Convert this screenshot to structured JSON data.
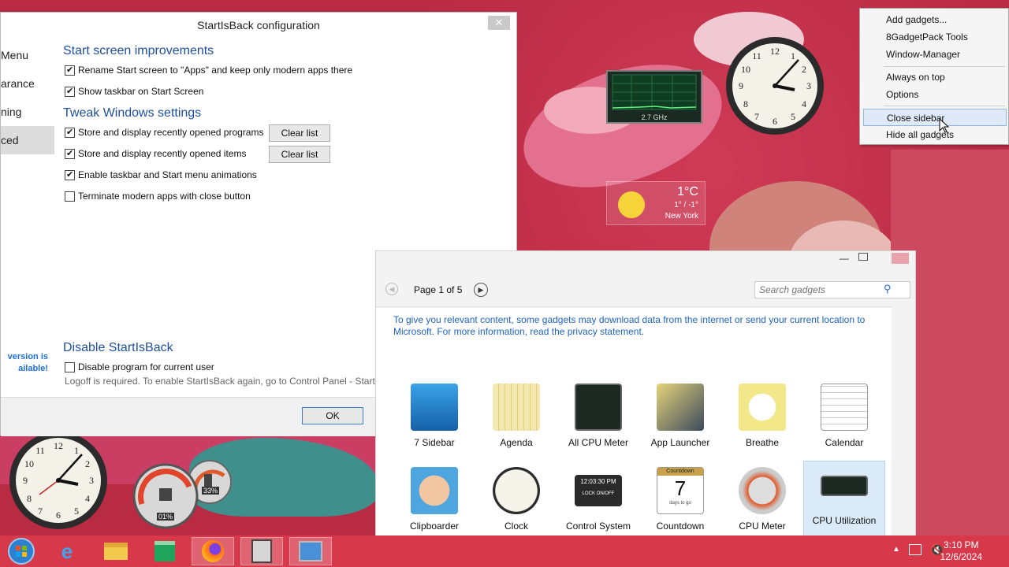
{
  "config": {
    "title": "StartIsBack configuration",
    "close": "✕",
    "nav": [
      "Menu",
      "arance",
      "ning",
      "ced"
    ],
    "sections": {
      "start_screen": "Start screen improvements",
      "tweak": "Tweak Windows settings",
      "disable": "Disable StartIsBack"
    },
    "options": {
      "rename_start": "Rename Start screen to \"Apps\" and keep only modern apps there",
      "show_taskbar": "Show taskbar on Start Screen",
      "store_programs": "Store and display recently opened programs",
      "store_items": "Store and display recently opened items",
      "animations": "Enable taskbar and Start menu animations",
      "terminate": "Terminate modern apps with close button",
      "disable_program": "Disable program for current user"
    },
    "clear_list": "Clear list",
    "logoff_note": "Logoff is required. To enable StartIsBack again, go to Control Panel - Start M",
    "new_version": "version is ailable!",
    "ok": "OK"
  },
  "gallery": {
    "page": "Page 1 of 5",
    "search_placeholder": "Search gadgets",
    "info": "To give you relevant content, some gadgets may download data from the internet or send your current location to Microsoft. For more information, read the privacy statement.",
    "items": [
      "7 Sidebar",
      "Agenda",
      "All CPU Meter",
      "App Launcher",
      "Breathe",
      "Calendar",
      "Clipboarder",
      "Clock",
      "Control System",
      "Countdown",
      "CPU Meter",
      "CPU Utilization"
    ]
  },
  "menu": {
    "items": [
      "Add gadgets...",
      "8GadgetPack Tools",
      "Window-Manager",
      "Always on top",
      "Options",
      "Close sidebar",
      "Hide all gadgets"
    ]
  },
  "desktop_gadgets": {
    "cpu_freq": "2.7 GHz",
    "weather_temp": "1°C",
    "weather_range": "1° / -1°",
    "weather_city": "New York",
    "cpu_pct": "01%",
    "ram_pct": "33%",
    "countdown_days": "7",
    "countdown_top": "Countdown",
    "countdown_sub": "days to go",
    "ctrl_time": "12:03:30 PM",
    "ctrl_lock": "LOCK ON/OFF"
  },
  "taskbar": {
    "time": "3:10 PM",
    "date": "12/6/2024"
  },
  "colors": {
    "wallpaper": "#c2334a",
    "taskbar": "#d7384a",
    "accent_blue": "#1e4f9c"
  }
}
